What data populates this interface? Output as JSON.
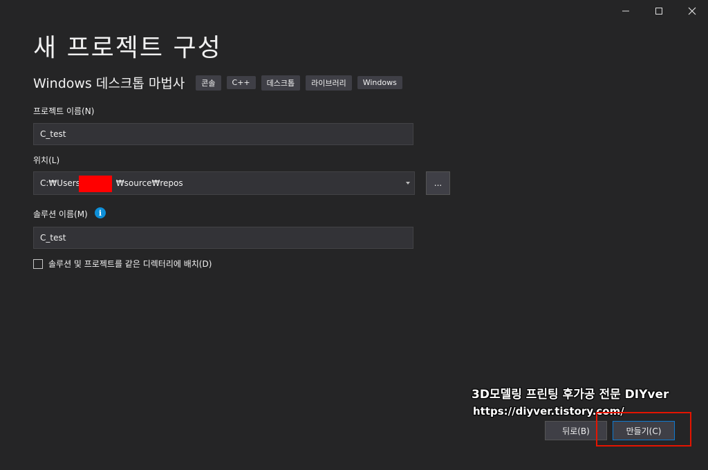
{
  "window": {
    "minimize": "minimize",
    "maximize": "maximize",
    "close": "close"
  },
  "title": "새 프로젝트 구성",
  "template": {
    "name": "Windows 데스크톱 마법사",
    "tags": [
      "콘솔",
      "C++",
      "데스크톱",
      "라이브러리",
      "Windows"
    ]
  },
  "project_name": {
    "label": "프로젝트 이름(N)",
    "value": "C_test"
  },
  "location": {
    "label": "위치(L)",
    "value_prefix": "C:₩Users₩",
    "value_suffix": "₩source₩repos",
    "browse_label": "..."
  },
  "solution_name": {
    "label": "솔루션 이름(M)",
    "value": "C_test",
    "info_glyph": "i"
  },
  "same_dir_checkbox": {
    "label": "솔루션 및 프로젝트를 같은 디렉터리에 배치(D)",
    "checked": false
  },
  "watermark": {
    "line1": "3D모델링 프린팅 후가공 전문 DIYver",
    "line2": "https://diyver.tistory.com/"
  },
  "buttons": {
    "back": "뒤로(B)",
    "create": "만들기(C)"
  },
  "colors": {
    "background": "#252526",
    "accent": "#0e7ad1",
    "highlight": "#e51400",
    "redaction": "#ff0000"
  }
}
